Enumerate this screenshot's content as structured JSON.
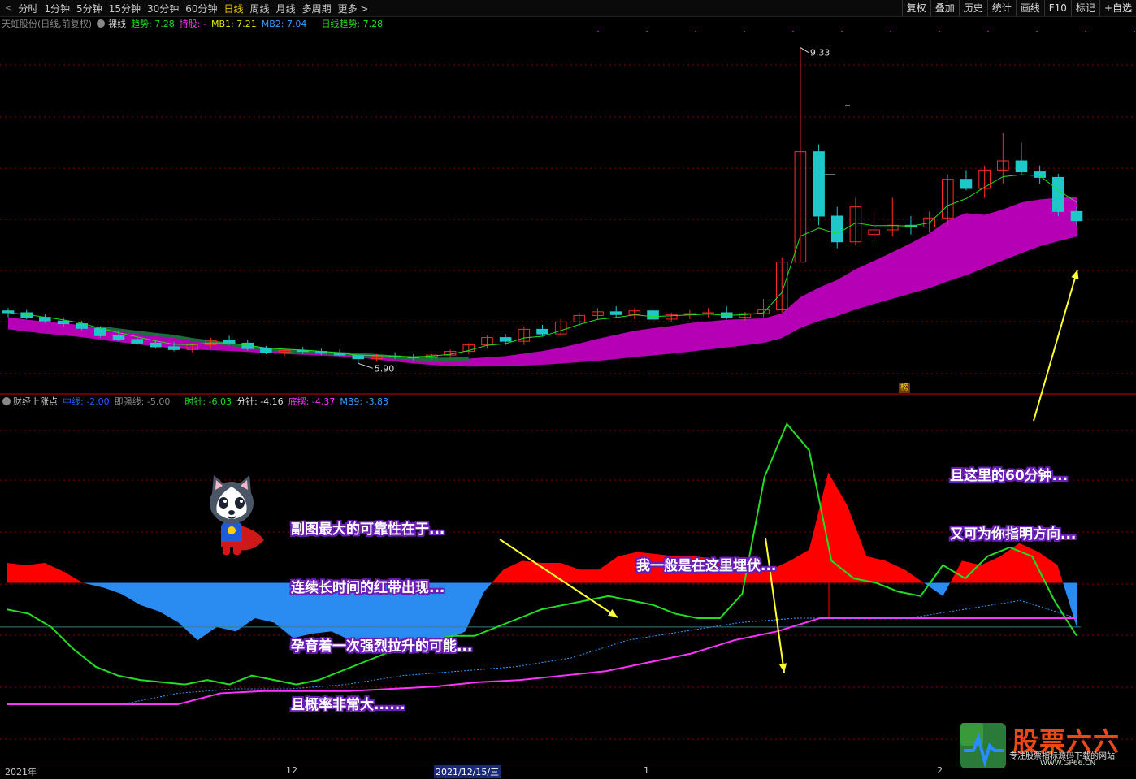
{
  "toolbar": {
    "arrow": "<",
    "periods": [
      "分时",
      "1分钟",
      "5分钟",
      "15分钟",
      "30分钟",
      "60分钟",
      "日线",
      "周线",
      "月线",
      "多周期",
      "更多 >"
    ],
    "active_period": "日线",
    "right_items": [
      "复权",
      "叠加",
      "历史",
      "统计",
      "画线",
      "F10",
      "标记",
      "+自选"
    ]
  },
  "main_info": {
    "stock_name": "天虹股份(日线,前复权)",
    "indicator": "裸线",
    "trend_label": "趋势: 7.28",
    "hold_label": "持股: -",
    "mb1_label": "MB1: 7.21",
    "mb2_label": "MB2: 7.04",
    "daily_trend_label": "日线趋势: 7.28"
  },
  "price_labels": {
    "high": "9.33",
    "low": "5.90"
  },
  "sub_info": {
    "name": "财经上涨点",
    "middle_line": "中线: -2.00",
    "gauge_line": "即强线: -5.00",
    "hour_needle": "时针: -6.03",
    "minute_needle": "分针: -4.16",
    "bottom_swing": "底摆: -4.37",
    "mb9": "MB9: -3.83"
  },
  "annotations": {
    "note1": [
      "副图最大的可靠性在于...",
      "连续长时间的红带出现...",
      "孕育着一次强烈拉升的可能...",
      "且概率非常大......"
    ],
    "note2": "我一般是在这里埋伏...",
    "note3": [
      "且这里的60分钟...",
      "又可为你指明方向..."
    ]
  },
  "x_axis": {
    "labels": [
      "2021年",
      "12",
      "2021/12/15/三",
      "1",
      "2"
    ]
  },
  "badge": "榜",
  "watermark": {
    "title": "股票六六",
    "subtitle": "专注股票指标源码下载的网站",
    "url": "WWW.GP66.CN"
  },
  "colors": {
    "up_candle": "#ff2a2a",
    "down_candle": "#1fc8c8",
    "magenta_band": "#c000c0",
    "green_line": "#22dd22",
    "red_area": "#ff0000",
    "blue_area": "#2a8cf0",
    "pink_line": "#ff33ff",
    "grid": "#8b0000"
  },
  "chart_data": [
    {
      "type": "candlestick",
      "title": "天虹股份(日线,前复权)",
      "annotated_high": 9.33,
      "annotated_low": 5.9,
      "candles_ohlc": [
        [
          6.47,
          6.5,
          6.4,
          6.45
        ],
        [
          6.45,
          6.48,
          6.38,
          6.4
        ],
        [
          6.4,
          6.44,
          6.34,
          6.36
        ],
        [
          6.36,
          6.4,
          6.3,
          6.33
        ],
        [
          6.33,
          6.36,
          6.26,
          6.28
        ],
        [
          6.28,
          6.3,
          6.18,
          6.2
        ],
        [
          6.2,
          6.26,
          6.14,
          6.16
        ],
        [
          6.16,
          6.2,
          6.1,
          6.12
        ],
        [
          6.12,
          6.16,
          6.06,
          6.08
        ],
        [
          6.08,
          6.13,
          6.03,
          6.05
        ],
        [
          6.05,
          6.12,
          6.02,
          6.1
        ],
        [
          6.1,
          6.18,
          6.06,
          6.15
        ],
        [
          6.15,
          6.2,
          6.1,
          6.12
        ],
        [
          6.12,
          6.16,
          6.04,
          6.06
        ],
        [
          6.06,
          6.09,
          6.0,
          6.02
        ],
        [
          6.02,
          6.06,
          5.98,
          6.04
        ],
        [
          6.04,
          6.08,
          6.0,
          6.03
        ],
        [
          6.03,
          6.06,
          5.99,
          6.01
        ],
        [
          6.01,
          6.05,
          5.97,
          5.99
        ],
        [
          5.99,
          6.0,
          5.9,
          5.95
        ],
        [
          5.95,
          6.0,
          5.92,
          5.98
        ],
        [
          5.98,
          6.02,
          5.95,
          5.97
        ],
        [
          5.97,
          6.0,
          5.93,
          5.96
        ],
        [
          5.96,
          6.0,
          5.94,
          5.99
        ],
        [
          5.99,
          6.05,
          5.96,
          6.03
        ],
        [
          6.03,
          6.12,
          6.0,
          6.1
        ],
        [
          6.1,
          6.2,
          6.06,
          6.18
        ],
        [
          6.18,
          6.22,
          6.1,
          6.14
        ],
        [
          6.14,
          6.3,
          6.1,
          6.27
        ],
        [
          6.27,
          6.32,
          6.2,
          6.22
        ],
        [
          6.22,
          6.38,
          6.2,
          6.35
        ],
        [
          6.35,
          6.45,
          6.3,
          6.42
        ],
        [
          6.42,
          6.5,
          6.38,
          6.46
        ],
        [
          6.46,
          6.52,
          6.4,
          6.43
        ],
        [
          6.43,
          6.5,
          6.38,
          6.47
        ],
        [
          6.47,
          6.5,
          6.36,
          6.38
        ],
        [
          6.38,
          6.45,
          6.35,
          6.43
        ],
        [
          6.43,
          6.48,
          6.38,
          6.44
        ],
        [
          6.44,
          6.5,
          6.4,
          6.45
        ],
        [
          6.45,
          6.52,
          6.38,
          6.4
        ],
        [
          6.4,
          6.46,
          6.36,
          6.44
        ],
        [
          6.44,
          6.6,
          6.4,
          6.48
        ],
        [
          6.48,
          7.05,
          6.45,
          7.0
        ],
        [
          7.0,
          9.33,
          7.0,
          8.2
        ],
        [
          8.2,
          8.28,
          7.4,
          7.5
        ],
        [
          7.5,
          7.6,
          7.15,
          7.22
        ],
        [
          7.22,
          7.7,
          7.18,
          7.6
        ],
        [
          7.3,
          7.55,
          7.22,
          7.35
        ],
        [
          7.35,
          7.7,
          7.28,
          7.4
        ],
        [
          7.4,
          7.5,
          7.3,
          7.38
        ],
        [
          7.38,
          7.55,
          7.32,
          7.48
        ],
        [
          7.48,
          7.95,
          7.4,
          7.9
        ],
        [
          7.9,
          8.0,
          7.78,
          7.8
        ],
        [
          7.8,
          8.05,
          7.7,
          8.0
        ],
        [
          8.0,
          8.4,
          7.85,
          8.1
        ],
        [
          8.1,
          8.3,
          7.95,
          7.98
        ],
        [
          7.98,
          8.05,
          7.85,
          7.92
        ],
        [
          7.92,
          7.96,
          7.5,
          7.55
        ],
        [
          7.55,
          7.6,
          7.4,
          7.45
        ]
      ]
    },
    {
      "type": "line",
      "title": "财经上涨点",
      "ylim": [
        -8,
        8
      ],
      "series": [
        {
          "name": "中线",
          "values": [
            -2.0
          ]
        },
        {
          "name": "即强线",
          "values": [
            -5.0
          ]
        },
        {
          "name": "时针",
          "values": [
            0.9,
            0.8,
            0.9,
            0.5,
            0.0,
            -0.2,
            -0.5,
            -1.0,
            -1.3,
            -1.8,
            -2.6,
            -2.0,
            -2.2,
            -1.6,
            -1.8,
            -2.5,
            -2.3,
            -2.2,
            -2.6,
            -3.0,
            -3.2,
            -2.8,
            -3.0,
            -2.6,
            -2.2,
            -0.4,
            0.6,
            1.0,
            0.9,
            0.9,
            0.6,
            0.6,
            1.2,
            1.4,
            1.3,
            1.2,
            1.2,
            1.1,
            0.9,
            0.8,
            0.6,
            1.0,
            1.5,
            5.0,
            3.5,
            1.2,
            1.0,
            0.6,
            0.0,
            -0.6,
            1.0,
            0.8,
            1.2,
            1.8,
            1.4,
            0.8,
            -2.0
          ]
        },
        {
          "name": "分针",
          "values": [
            -1.2,
            -1.4,
            -2.0,
            -3.0,
            -3.8,
            -4.2,
            -4.4,
            -4.5,
            -4.6,
            -4.4,
            -4.6,
            -4.2,
            -4.4,
            -4.6,
            -4.4,
            -4.0,
            -3.6,
            -3.2,
            -3.0,
            -2.6,
            -2.4,
            -2.4,
            -2.0,
            -1.6,
            -1.2,
            -1.0,
            -0.8,
            -0.6,
            -0.8,
            -1.0,
            -1.4,
            -1.6,
            -1.6,
            -0.5,
            4.8,
            7.2,
            6.0,
            1.0,
            0.2,
            0.0,
            -0.4,
            -0.6,
            0.8,
            0.2,
            1.2,
            1.6,
            1.2,
            -0.8,
            -2.4
          ]
        },
        {
          "name": "底摆",
          "values": [
            -5.5,
            -5.5,
            -5.5,
            -5.5,
            -5.5,
            -5.0,
            -4.9,
            -4.9,
            -4.9,
            -4.8,
            -4.7,
            -4.5,
            -4.4,
            -4.2,
            -4.0,
            -3.6,
            -3.2,
            -2.6,
            -2.2,
            -1.6,
            -1.6,
            -1.6,
            -1.6,
            -1.6,
            -1.6,
            -1.6
          ]
        },
        {
          "name": "MB9",
          "values": [
            -5.5,
            -5.0,
            -4.8,
            -4.8,
            -4.6,
            -4.2,
            -4.0,
            -3.8,
            -3.4,
            -2.6,
            -2.2,
            -1.8,
            -1.6,
            -1.6,
            -1.6,
            -1.2,
            -0.8,
            -1.6
          ]
        }
      ]
    }
  ]
}
